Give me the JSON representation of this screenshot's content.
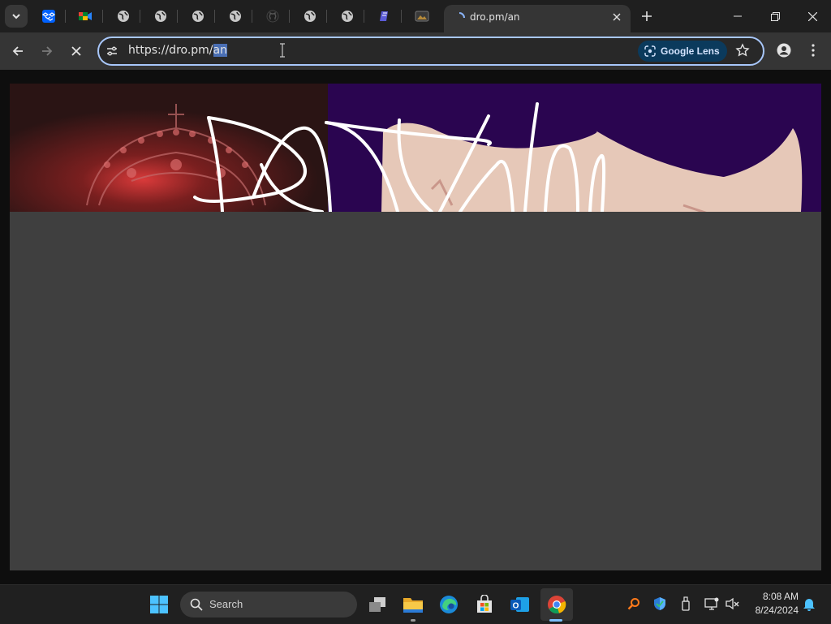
{
  "tabs": {
    "pinned": [
      {
        "icon": "dropbox-icon"
      },
      {
        "icon": "google-meet-icon"
      },
      {
        "icon": "globe-icon"
      },
      {
        "icon": "globe-icon"
      },
      {
        "icon": "globe-icon"
      },
      {
        "icon": "globe-icon"
      },
      {
        "icon": "github-icon"
      },
      {
        "icon": "globe-icon"
      },
      {
        "icon": "globe-icon"
      },
      {
        "icon": "notes-icon"
      },
      {
        "icon": "image-icon"
      }
    ],
    "active": {
      "title": "dro.pm/an",
      "icon": "loading-icon"
    }
  },
  "toolbar": {
    "url_prefix": "https://dro.pm/",
    "url_selected": "an",
    "lens_label": "Google Lens"
  },
  "taskbar": {
    "search_placeholder": "Search",
    "time": "8:08 AM",
    "date": "8/24/2024"
  },
  "colors": {
    "accent": "#a8c7fa",
    "banner_left": "#3a1515",
    "banner_right": "#2a0550",
    "skin": "#e6c8b8"
  }
}
